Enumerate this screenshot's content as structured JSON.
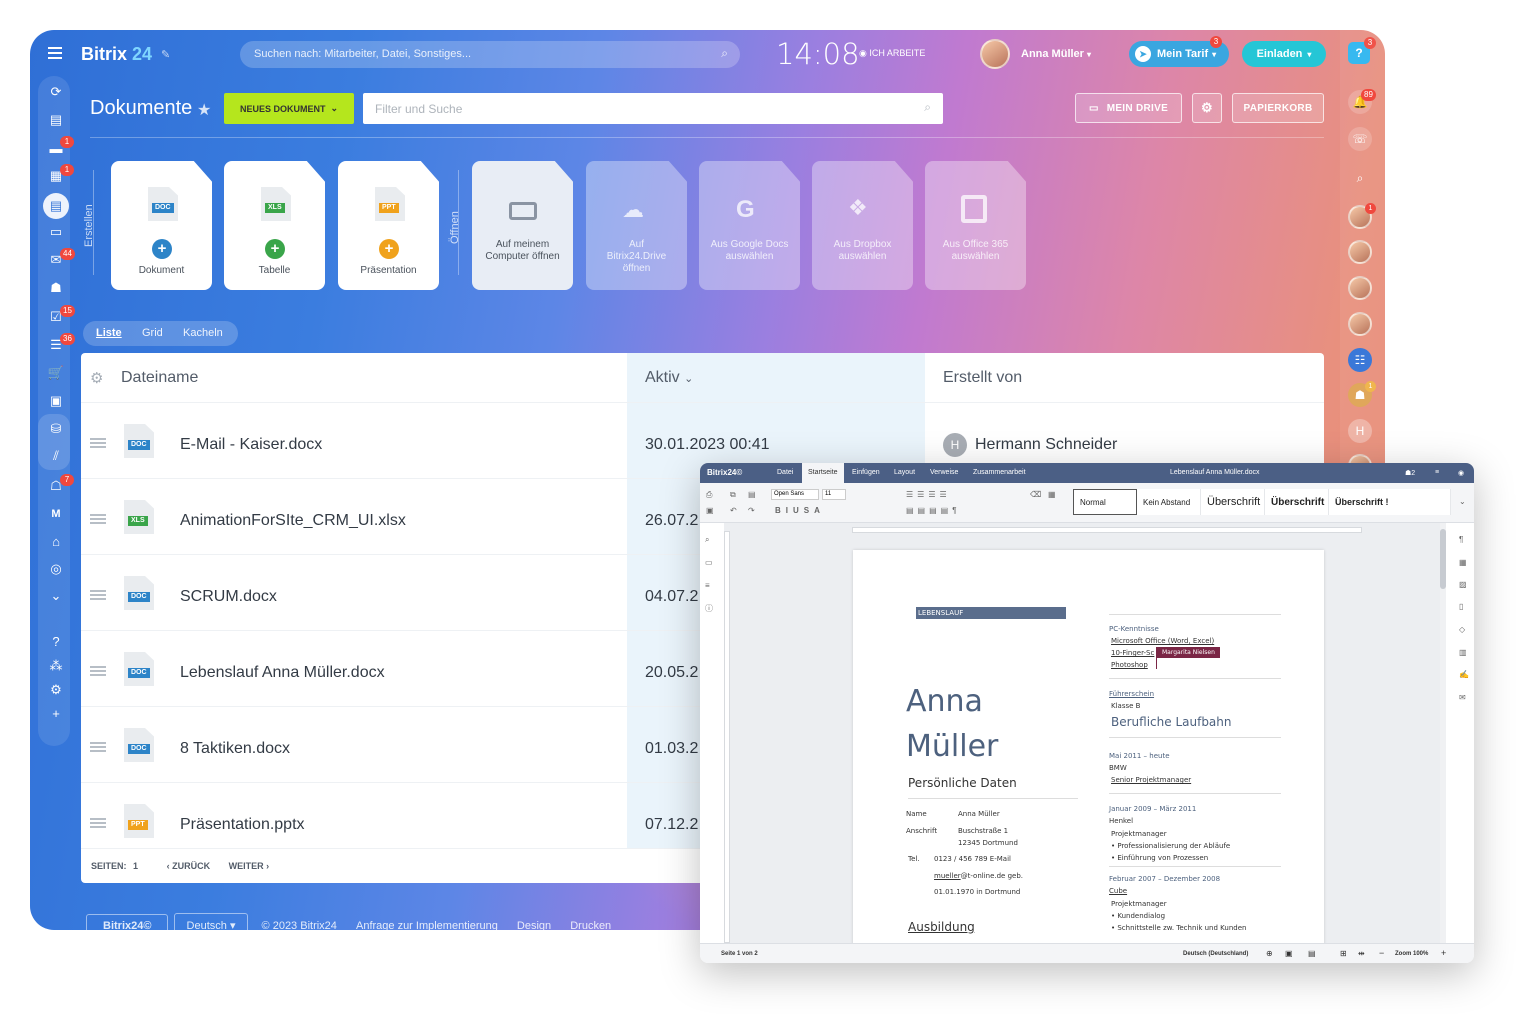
{
  "header": {
    "brand": "Bitrix",
    "brand_num": "24",
    "search_placeholder": "Suchen nach: Mitarbeiter, Datei, Sonstiges...",
    "clock": "14:08",
    "work_status": "ICH ARBEITE",
    "user_name": "Anna Müller",
    "tariff_label": "Mein Tarif",
    "tariff_badge": "3",
    "invite_label": "Einladen",
    "help_badge": "3"
  },
  "page": {
    "title": "Dokumente",
    "new_doc_label": "NEUES DOKUMENT",
    "filter_placeholder": "Filter und Suche",
    "my_drive_label": "MEIN DRIVE",
    "trash_label": "PAPIERKORB"
  },
  "create_section": {
    "label": "Erstellen",
    "open_label": "Öffnen"
  },
  "tiles": [
    {
      "tag": "DOC",
      "label": "Dokument"
    },
    {
      "tag": "XLS",
      "label": "Tabelle"
    },
    {
      "tag": "PPT",
      "label": "Präsentation"
    },
    {
      "label": "Auf meinem Computer öffnen"
    },
    {
      "label": "Auf Bitrix24.Drive öffnen"
    },
    {
      "label": "Aus Google Docs auswählen"
    },
    {
      "label": "Aus Dropbox auswählen"
    },
    {
      "label": "Aus Office 365 auswählen"
    }
  ],
  "views": [
    "Liste",
    "Grid",
    "Kacheln"
  ],
  "table": {
    "col_name": "Dateiname",
    "col_active": "Aktiv",
    "col_creator": "Erstellt von",
    "rows": [
      {
        "tag": "DOC",
        "name": "E-Mail - Kaiser.docx",
        "date": "30.01.2023 00:41",
        "creator_initial": "H",
        "creator": "Hermann Schneider"
      },
      {
        "tag": "XLS",
        "name": "AnimationForSIte_CRM_UI.xlsx",
        "date": "26.07.2"
      },
      {
        "tag": "DOC",
        "name": "SCRUM.docx",
        "date": "04.07.2"
      },
      {
        "tag": "DOC",
        "name": "Lebenslauf Anna Müller.docx",
        "date": "20.05.2"
      },
      {
        "tag": "DOC",
        "name": "8 Taktiken.docx",
        "date": "01.03.2"
      },
      {
        "tag": "PPT",
        "name": "Präsentation.pptx",
        "date": "07.12.2"
      }
    ]
  },
  "pagination": {
    "pages_label": "SEITEN:",
    "page": "1",
    "back": "ZURÜCK",
    "next": "WEITER"
  },
  "footer": {
    "brand": "Bitrix24©",
    "lang": "Deutsch",
    "copyright": "© 2023 Bitrix24",
    "impl": "Anfrage zur Implementierung",
    "design": "Design",
    "print": "Drucken"
  },
  "left_badges": {
    "chat": "1",
    "calendar": "1",
    "mail": "44",
    "tasks": "15",
    "filter": "36",
    "bot": "7"
  },
  "right_badges": {
    "bell": "89",
    "avatar1": "1",
    "group": "1"
  },
  "right_initial": "H",
  "editor": {
    "brand": "Bitrix24©",
    "menu": [
      "Datei",
      "Startseite",
      "Einfügen",
      "Layout",
      "Verweise",
      "Zusammenarbeit"
    ],
    "doc_title": "Lebenslauf Anna Müller.docx",
    "font": "Open Sans",
    "font_size": "11",
    "styles": [
      "Normal",
      "Kein Abstand",
      "Überschrift",
      "Überschrift",
      "Überschrift !"
    ],
    "cv": {
      "section": "LEBENSLAUF",
      "first": "Anna",
      "last": "Müller",
      "personal": "Persönliche Daten",
      "name_label": "Name",
      "name_val": "Anna Müller",
      "addr_label": "Anschrift",
      "addr1": "Buschstraße 1",
      "addr2": "12345 Dortmund",
      "tel_label": "Tel.",
      "tel_val": "0123 / 456 789 E-Mail",
      "email": "mueller",
      "email_rest": "@t-online.de geb.",
      "birth": "01.01.1970 in Dortmund",
      "education": "Ausbildung",
      "pc": "PC-Kenntnisse",
      "ms": "Microsoft Office (Word, Excel)",
      "finger": "10-Finger-Sc",
      "photoshop": "Photoshop",
      "collab": "Margarita Nielsen",
      "license": "Führerschein",
      "license_class": "Klasse B",
      "career": "Berufliche Laufbahn",
      "job1_date": "Mai 2011 – heute",
      "job1_co": "BMW",
      "job1_role": "Senior Projektmanager",
      "job2_date": "Januar 2009 – März 2011",
      "job2_co": "Henkel",
      "job2_role": "Projektmanager",
      "job2_b1": "Professionalisierung der Abläufe",
      "job2_b2": "Einführung von Prozessen",
      "job3_date": "Februar 2007 – Dezember 2008",
      "job3_co": "Cube",
      "job3_role": "Projektmanager",
      "job3_b1": "Kundendialog",
      "job3_b2": "Schnittstelle zw. Technik und Kunden"
    },
    "status_page": "Seite 1 von 2",
    "status_lang": "Deutsch (Deutschland)",
    "zoom": "Zoom 100%"
  },
  "colors": {
    "accent_green": "#b5e61d",
    "badge_red": "#f0483e",
    "invite": "#25c6d6",
    "tariff": "#3aa6e0"
  }
}
